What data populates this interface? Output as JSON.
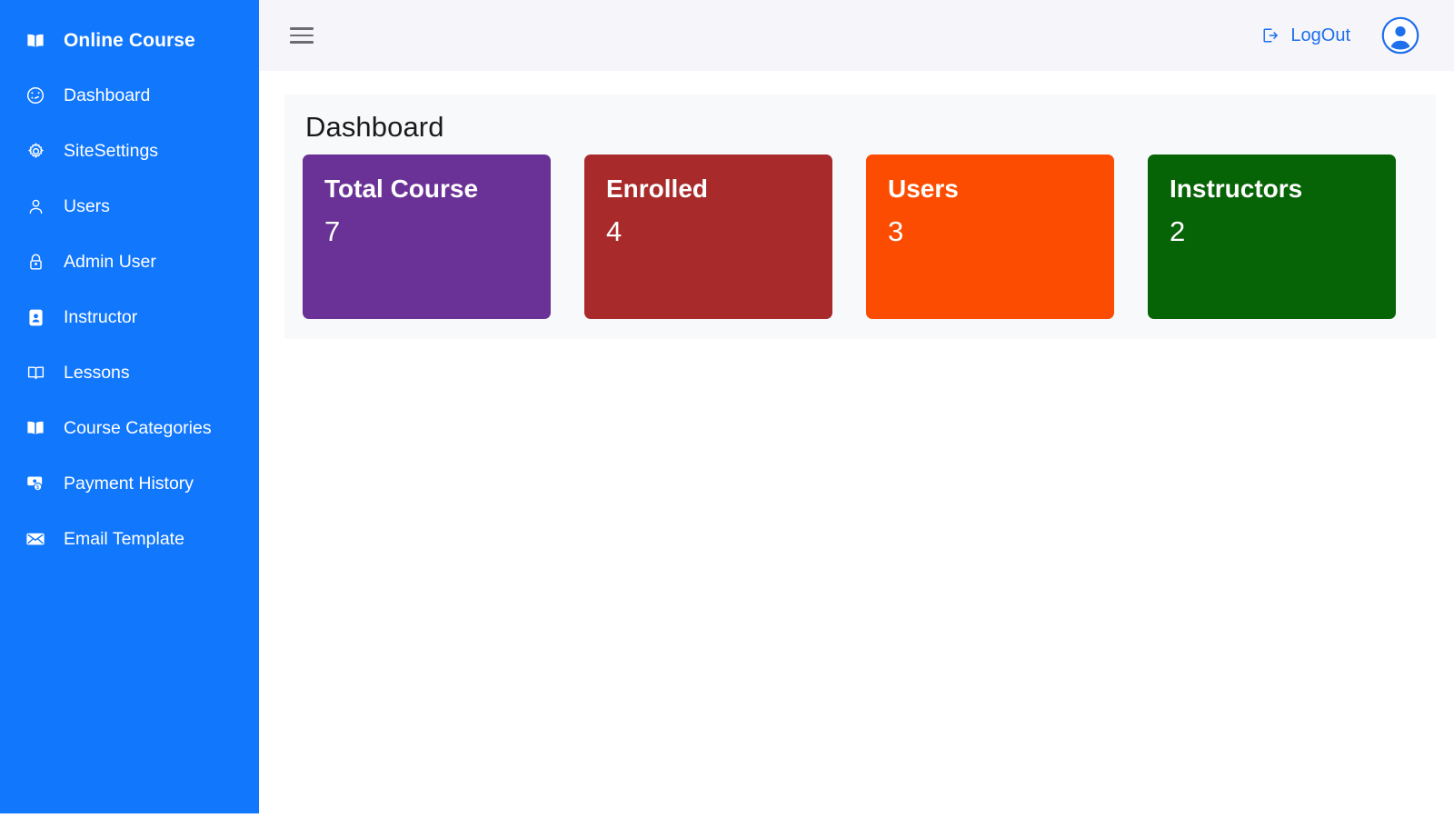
{
  "sidebar": {
    "brand": {
      "label": "Online Course",
      "icon": "book-open-icon"
    },
    "items": [
      {
        "label": "Dashboard",
        "icon": "gauge-icon"
      },
      {
        "label": "SiteSettings",
        "icon": "gear-icon"
      },
      {
        "label": "Users",
        "icon": "person-icon"
      },
      {
        "label": "Admin User",
        "icon": "lock-person-icon"
      },
      {
        "label": "Instructor",
        "icon": "id-badge-icon"
      },
      {
        "label": "Lessons",
        "icon": "book-icon"
      },
      {
        "label": "Course Categories",
        "icon": "book-open-icon"
      },
      {
        "label": "Payment History",
        "icon": "money-icon"
      },
      {
        "label": "Email Template",
        "icon": "envelope-icon"
      }
    ],
    "background_color": "#1177FD"
  },
  "topbar": {
    "menu_toggle_icon": "hamburger-icon",
    "logout_label": "LogOut",
    "logout_icon": "sign-out-icon",
    "logout_color": "#1E6FEB",
    "avatar_icon": "user-circle-icon",
    "background_color": "#F5F5FA"
  },
  "main": {
    "page_title": "Dashboard",
    "panel_background": "#F8F9FB",
    "cards": [
      {
        "label": "Total Course",
        "value": "7",
        "color": "#6A3196"
      },
      {
        "label": "Enrolled",
        "value": "4",
        "color": "#A82A2A"
      },
      {
        "label": "Users",
        "value": "3",
        "color": "#FC4C02"
      },
      {
        "label": "Instructors",
        "value": "2",
        "color": "#066306"
      }
    ]
  }
}
